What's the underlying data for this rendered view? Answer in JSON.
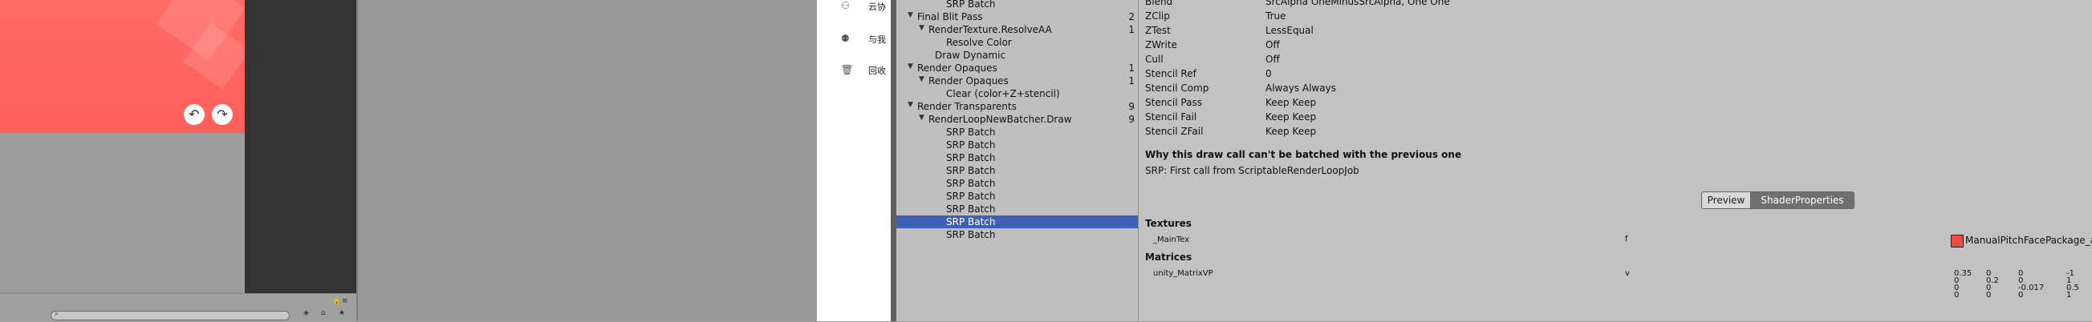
{
  "file_panel": {
    "items": [
      {
        "label": "云协",
        "icon": "people-icon"
      },
      {
        "label": "与我",
        "icon": "shared-user-icon"
      },
      {
        "label": "回收",
        "icon": "trash-icon"
      }
    ]
  },
  "hierarchy": {
    "rows": [
      {
        "label": "SRP Batch",
        "count": "",
        "indent": 3,
        "expander": false,
        "selected": false
      },
      {
        "label": "Final Blit Pass",
        "count": "2",
        "indent": 1,
        "expander": true,
        "selected": false
      },
      {
        "label": "RenderTexture.ResolveAA",
        "count": "1",
        "indent": 2,
        "expander": true,
        "selected": false
      },
      {
        "label": "Resolve Color",
        "count": "",
        "indent": 3,
        "expander": false,
        "selected": false
      },
      {
        "label": "Draw Dynamic",
        "count": "",
        "indent": 2,
        "expander": false,
        "selected": false
      },
      {
        "label": "Render Opaques",
        "count": "1",
        "indent": 1,
        "expander": true,
        "selected": false
      },
      {
        "label": "Render Opaques",
        "count": "1",
        "indent": 2,
        "expander": true,
        "selected": false
      },
      {
        "label": "Clear (color+Z+stencil)",
        "count": "",
        "indent": 3,
        "expander": false,
        "selected": false
      },
      {
        "label": "Render Transparents",
        "count": "9",
        "indent": 1,
        "expander": true,
        "selected": false
      },
      {
        "label": "RenderLoopNewBatcher.Draw",
        "count": "9",
        "indent": 2,
        "expander": true,
        "selected": false
      },
      {
        "label": "SRP Batch",
        "count": "",
        "indent": 3,
        "expander": false,
        "selected": false
      },
      {
        "label": "SRP Batch",
        "count": "",
        "indent": 3,
        "expander": false,
        "selected": false
      },
      {
        "label": "SRP Batch",
        "count": "",
        "indent": 3,
        "expander": false,
        "selected": false
      },
      {
        "label": "SRP Batch",
        "count": "",
        "indent": 3,
        "expander": false,
        "selected": false
      },
      {
        "label": "SRP Batch",
        "count": "",
        "indent": 3,
        "expander": false,
        "selected": false
      },
      {
        "label": "SRP Batch",
        "count": "",
        "indent": 3,
        "expander": false,
        "selected": false
      },
      {
        "label": "SRP Batch",
        "count": "",
        "indent": 3,
        "expander": false,
        "selected": false
      },
      {
        "label": "SRP Batch",
        "count": "",
        "indent": 3,
        "expander": false,
        "selected": true
      },
      {
        "label": "SRP Batch",
        "count": "",
        "indent": 3,
        "expander": false,
        "selected": false
      }
    ]
  },
  "details": {
    "properties": [
      {
        "name": "Blend",
        "value": "SrcAlpha OneMinusSrcAlpha, One One"
      },
      {
        "name": "ZClip",
        "value": "True"
      },
      {
        "name": "ZTest",
        "value": "LessEqual"
      },
      {
        "name": "ZWrite",
        "value": "Off"
      },
      {
        "name": "Cull",
        "value": "Off"
      },
      {
        "name": "Stencil Ref",
        "value": "0"
      },
      {
        "name": "Stencil Comp",
        "value": "Always Always"
      },
      {
        "name": "Stencil Pass",
        "value": "Keep Keep"
      },
      {
        "name": "Stencil Fail",
        "value": "Keep Keep"
      },
      {
        "name": "Stencil ZFail",
        "value": "Keep Keep"
      }
    ],
    "batch_heading": "Why this draw call can't be batched with the previous one",
    "batch_reason": "SRP: First call from ScriptableRenderLoopJob",
    "tabs": {
      "preview": "Preview",
      "shader_properties": "ShaderProperties"
    },
    "textures_heading": "Textures",
    "texture": {
      "name": "_MainTex",
      "stage": "f",
      "value": "ManualPitchFacePackage_at"
    },
    "matrices_heading": "Matrices",
    "matrix": {
      "name": "unity_MatrixVP",
      "stage": "v",
      "rows": [
        [
          "0.35",
          "0",
          "0",
          "-1"
        ],
        [
          "0",
          "0.2",
          "0",
          "1"
        ],
        [
          "0",
          "0",
          "-0.017",
          "0.5"
        ],
        [
          "0",
          "0",
          "0",
          "1"
        ]
      ]
    }
  },
  "game_view": {
    "undo_icon": "undo-icon",
    "redo_icon": "redo-icon",
    "gradient_top": "#ff6b66",
    "gradient_bottom": "#ff5f5b"
  },
  "colors": {
    "selection": "#3c5fb8",
    "panel": "#c2c2c2"
  }
}
